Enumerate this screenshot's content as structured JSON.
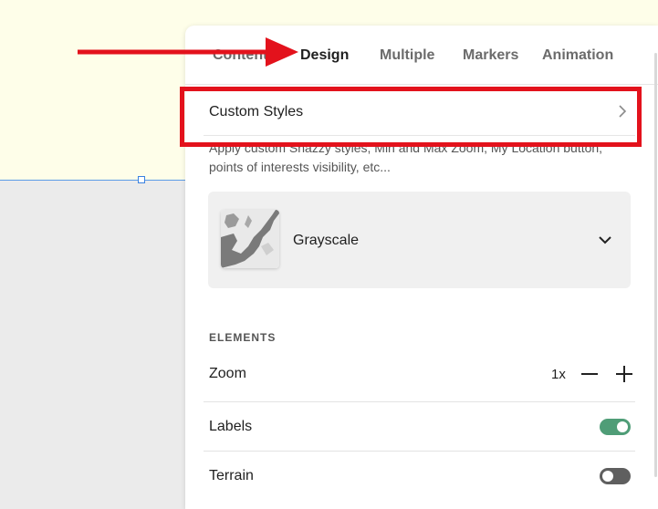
{
  "tabs": [
    {
      "label": "Content",
      "active": false
    },
    {
      "label": "Design",
      "active": true
    },
    {
      "label": "Multiple",
      "active": false
    },
    {
      "label": "Markers",
      "active": false
    },
    {
      "label": "Animation",
      "active": false
    }
  ],
  "custom_styles": {
    "label": "Custom Styles",
    "description": "Apply custom Snazzy styles, Min and Max Zoom, My Location button, points of interests visibility, etc..."
  },
  "map_style": {
    "selected": "Grayscale",
    "thumbnail_icon": "grayscale-map-thumbnail"
  },
  "elements": {
    "title": "ELEMENTS",
    "zoom": {
      "label": "Zoom",
      "value": "1x"
    },
    "labels": {
      "label": "Labels",
      "enabled": true
    },
    "terrain": {
      "label": "Terrain",
      "enabled": false
    }
  },
  "colors": {
    "annotation": "#e3121c",
    "toggle_on": "#4f9d77",
    "toggle_off": "#5f5f5f",
    "selection": "#3b82e0"
  }
}
